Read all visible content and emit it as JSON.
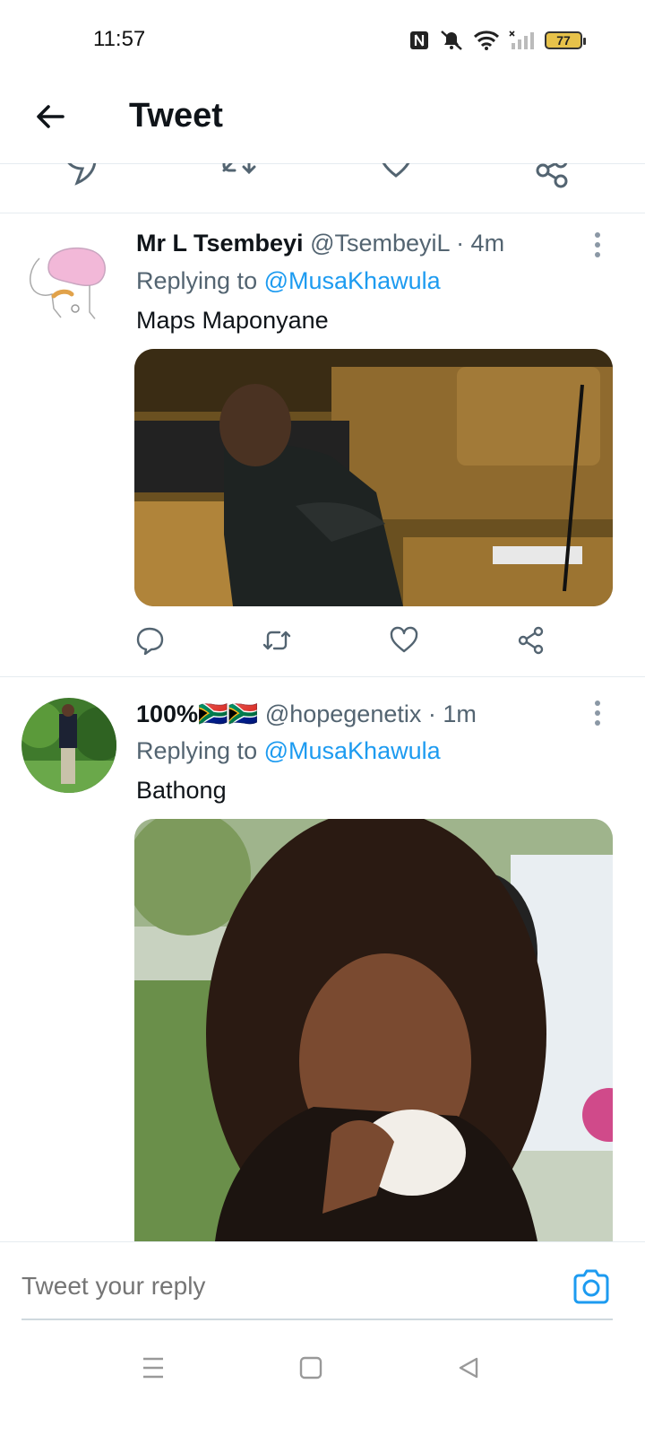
{
  "status_bar": {
    "time": "11:57",
    "battery": "77"
  },
  "header": {
    "title": "Tweet"
  },
  "tweets": [
    {
      "name": "Mr L Tsembeyi",
      "handle": "@TsembeyiL",
      "time": "· 4m",
      "replying_label": "Replying to",
      "replying_to": "@MusaKhawula",
      "text": "Maps Maponyane"
    },
    {
      "name": "100%🇿🇦🇿🇦",
      "handle": "@hopegenetix",
      "time": "· 1m",
      "replying_label": "Replying to",
      "replying_to": "@MusaKhawula",
      "text": "Bathong"
    }
  ],
  "reply_bar": {
    "placeholder": "Tweet your reply"
  },
  "icons": {
    "back": "arrow-left-icon",
    "reply": "reply-icon",
    "retweet": "retweet-icon",
    "like": "heart-icon",
    "share": "share-icon",
    "more": "more-vertical-icon",
    "camera": "camera-icon",
    "menu": "menu-icon",
    "home": "square-icon",
    "back_nav": "triangle-back-icon"
  },
  "colors": {
    "accent": "#1d9bf0",
    "secondary_text": "#536471",
    "text": "#0f1419"
  }
}
